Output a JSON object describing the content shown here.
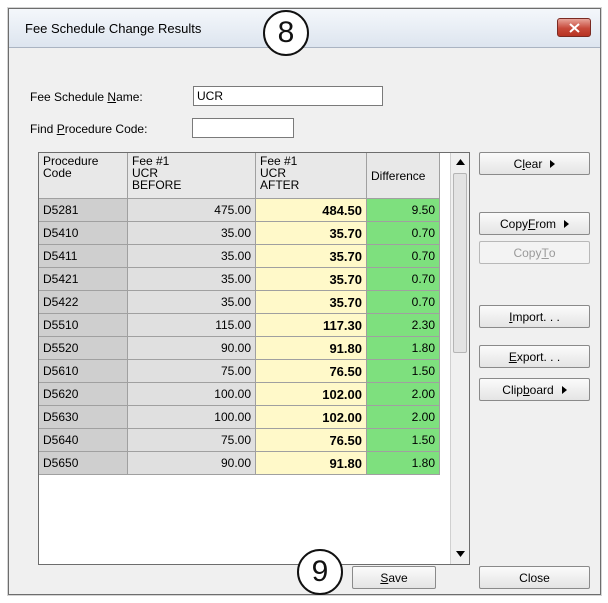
{
  "window": {
    "title": "Fee Schedule Change Results"
  },
  "callouts": {
    "top": "8",
    "bottom": "9"
  },
  "fields": {
    "fee_schedule_name": {
      "label_pre": "Fee Schedule ",
      "label_key": "N",
      "label_post": "ame:",
      "value": "UCR"
    },
    "find_procedure_code": {
      "label_pre": "Find ",
      "label_key": "P",
      "label_post": "rocedure Code:",
      "value": ""
    }
  },
  "table": {
    "headers": [
      "Procedure\nCode",
      "Fee #1\nUCR\nBEFORE",
      "Fee #1\nUCR\nAFTER",
      "Difference"
    ],
    "rows": [
      {
        "code": "D5281",
        "before": "475.00",
        "after": "484.50",
        "diff": "9.50"
      },
      {
        "code": "D5410",
        "before": "35.00",
        "after": "35.70",
        "diff": "0.70"
      },
      {
        "code": "D5411",
        "before": "35.00",
        "after": "35.70",
        "diff": "0.70"
      },
      {
        "code": "D5421",
        "before": "35.00",
        "after": "35.70",
        "diff": "0.70"
      },
      {
        "code": "D5422",
        "before": "35.00",
        "after": "35.70",
        "diff": "0.70"
      },
      {
        "code": "D5510",
        "before": "115.00",
        "after": "117.30",
        "diff": "2.30"
      },
      {
        "code": "D5520",
        "before": "90.00",
        "after": "91.80",
        "diff": "1.80"
      },
      {
        "code": "D5610",
        "before": "75.00",
        "after": "76.50",
        "diff": "1.50"
      },
      {
        "code": "D5620",
        "before": "100.00",
        "after": "102.00",
        "diff": "2.00"
      },
      {
        "code": "D5630",
        "before": "100.00",
        "after": "102.00",
        "diff": "2.00"
      },
      {
        "code": "D5640",
        "before": "75.00",
        "after": "76.50",
        "diff": "1.50"
      },
      {
        "code": "D5650",
        "before": "90.00",
        "after": "91.80",
        "diff": "1.80"
      }
    ]
  },
  "buttons": {
    "clear": {
      "pre": "C",
      "key": "l",
      "post": "ear"
    },
    "copy_from": {
      "pre": "Copy ",
      "key": "F",
      "post": "rom"
    },
    "copy_to": {
      "pre": "Copy ",
      "key": "T",
      "post": "o"
    },
    "import": {
      "pre": "",
      "key": "I",
      "post": "mport. . ."
    },
    "export": {
      "pre": "",
      "key": "E",
      "post": "xport. . ."
    },
    "clipboard": {
      "pre": "Clip",
      "key": "b",
      "post": "oard"
    },
    "save": {
      "pre": "",
      "key": "S",
      "post": "ave"
    },
    "close": {
      "label": "Close"
    }
  },
  "icons": {
    "close": "close-x-icon",
    "scroll_up": "scroll-up-arrow-icon",
    "scroll_down": "scroll-down-arrow-icon",
    "submenu": "submenu-triangle-icon"
  },
  "colors": {
    "before_col": "#e0e0e0",
    "after_col": "#fff9c9",
    "diff_col": "#7ee07e",
    "code_col": "#cfcfcf"
  }
}
